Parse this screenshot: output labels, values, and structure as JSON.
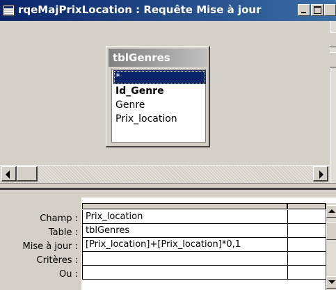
{
  "window": {
    "title": "rqeMajPrixLocation : Requête Mise à jour",
    "titlebar_color": "#0a246a"
  },
  "field_list": {
    "table_name": "tblGenres",
    "items": [
      {
        "label": "*",
        "selected": true
      },
      {
        "label": "Id_Genre",
        "key": true
      },
      {
        "label": "Genre"
      },
      {
        "label": "Prix_location"
      }
    ]
  },
  "grid": {
    "row_labels": {
      "field": "Champ :",
      "table": "Table :",
      "update_to": "Mise à jour :",
      "criteria": "Critères :",
      "or": "Ou :"
    },
    "column1": {
      "field": "Prix_location",
      "table": "tblGenres",
      "update_to": "[Prix_location]+[Prix_location]*0,1",
      "criteria": "",
      "or": ""
    },
    "column2": {
      "field": "",
      "table": "",
      "update_to": "",
      "criteria": "",
      "or": ""
    }
  }
}
